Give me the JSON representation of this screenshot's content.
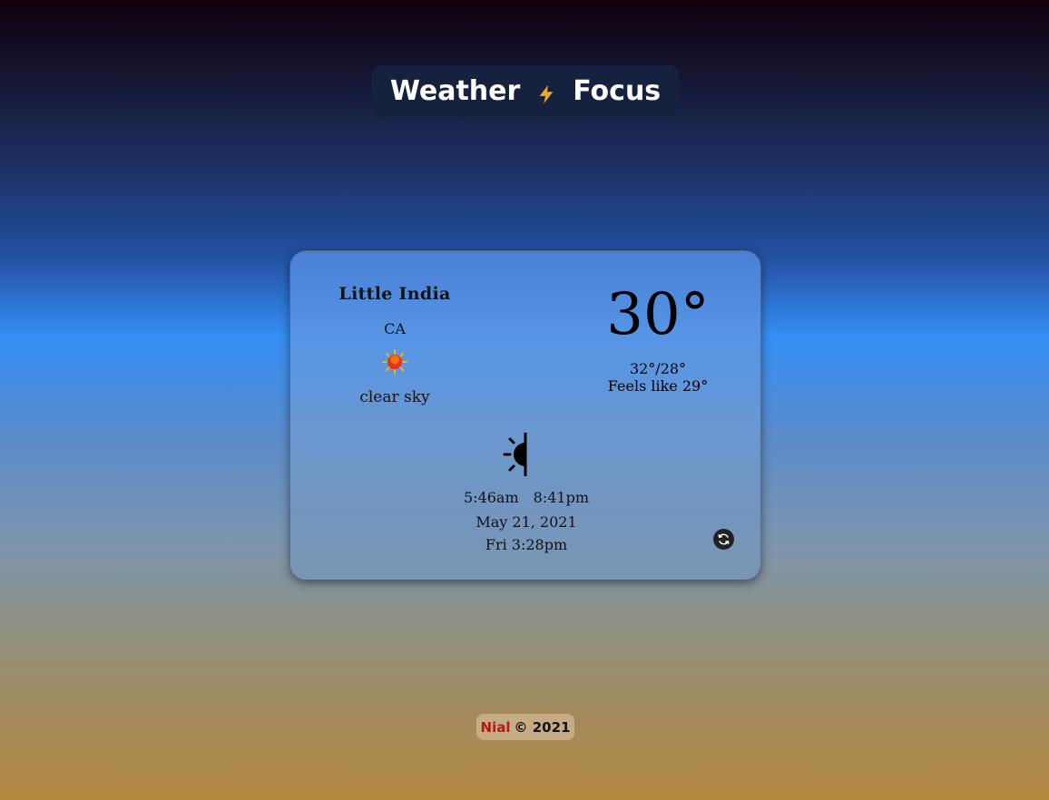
{
  "header": {
    "title_left": "Weather",
    "title_right": "Focus",
    "icon": "lightning-bolt-icon",
    "bolt_color": "#f5a623"
  },
  "weather": {
    "city": "Little India",
    "country": "CA",
    "condition_icon": "sun-icon",
    "description": "clear sky",
    "temperature": "30°",
    "range": "32°/28°",
    "feels_like": "Feels like 29°",
    "day_night_icon": "sun-moon-icon",
    "sunrise": "5:46am",
    "sunset": "8:41pm",
    "date": "May 21, 2021",
    "day_time": "Fri 3:28pm",
    "refresh_icon": "refresh-icon"
  },
  "footer": {
    "author": "Nial",
    "copyright": "© 2021",
    "author_color": "#b01a10"
  }
}
